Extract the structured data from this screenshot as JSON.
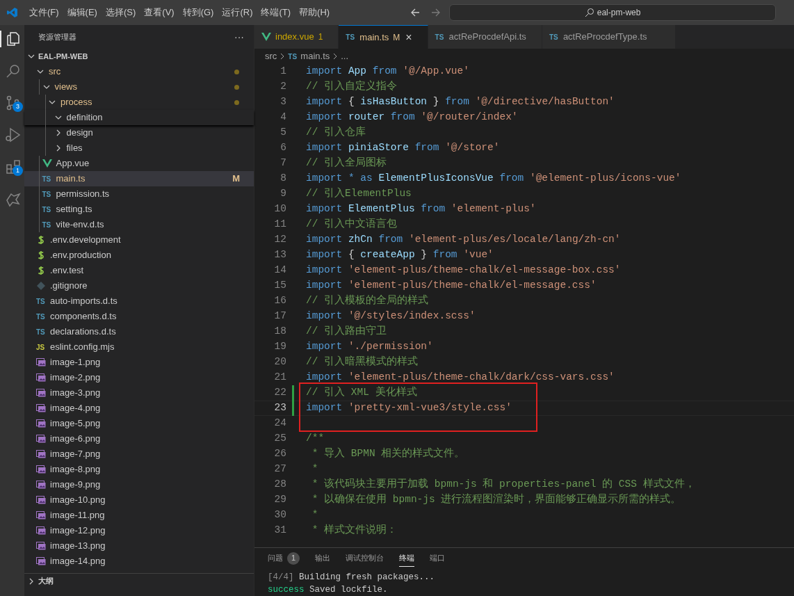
{
  "menu": [
    "文件(F)",
    "编辑(E)",
    "选择(S)",
    "查看(V)",
    "转到(G)",
    "运行(R)",
    "终端(T)",
    "帮助(H)"
  ],
  "search": {
    "value": "eal-pm-web"
  },
  "activity_bar": [
    {
      "kind": "files",
      "selected": true
    },
    {
      "kind": "search",
      "selected": false
    },
    {
      "kind": "source-control",
      "selected": false,
      "badge": "3"
    },
    {
      "kind": "run",
      "selected": false
    },
    {
      "kind": "extensions",
      "selected": false,
      "badge": "1"
    },
    {
      "kind": "remote",
      "selected": false
    }
  ],
  "sidebar": {
    "title": "资源管理器",
    "more": "···",
    "root": {
      "label": "EAL-PM-WEB",
      "expanded": true
    },
    "tree": [
      {
        "label": "src",
        "kind": "folder",
        "expanded": true,
        "modified": true,
        "children": [
          {
            "label": "views",
            "kind": "folder",
            "expanded": true,
            "modified": true,
            "children": [
              {
                "label": "process",
                "kind": "folder",
                "expanded": true,
                "modified": true,
                "children": [
                  {
                    "label": "definition",
                    "kind": "folder",
                    "expanded": true,
                    "sticky": true
                  },
                  {
                    "label": "design",
                    "kind": "folder",
                    "expanded": false
                  },
                  {
                    "label": "files",
                    "kind": "folder",
                    "expanded": false
                  }
                ]
              }
            ]
          },
          {
            "label": "App.vue",
            "kind": "vue"
          },
          {
            "label": "main.ts",
            "kind": "ts",
            "icon_text": "TS",
            "selected": true,
            "modified": true,
            "badge": "M"
          },
          {
            "label": "permission.ts",
            "kind": "ts",
            "icon_text": "TS"
          },
          {
            "label": "setting.ts",
            "kind": "ts",
            "icon_text": "TS"
          },
          {
            "label": "vite-env.d.ts",
            "kind": "ts",
            "icon_text": "TS"
          }
        ]
      },
      {
        "label": ".env.development",
        "kind": "env"
      },
      {
        "label": ".env.production",
        "kind": "env"
      },
      {
        "label": ".env.test",
        "kind": "env"
      },
      {
        "label": ".gitignore",
        "kind": "git"
      },
      {
        "label": "auto-imports.d.ts",
        "kind": "ts",
        "icon_text": "TS"
      },
      {
        "label": "components.d.ts",
        "kind": "ts",
        "icon_text": "TS"
      },
      {
        "label": "declarations.d.ts",
        "kind": "ts",
        "icon_text": "TS"
      },
      {
        "label": "eslint.config.mjs",
        "kind": "js",
        "icon_text": "JS"
      },
      {
        "label": "image-1.png",
        "kind": "image"
      },
      {
        "label": "image-2.png",
        "kind": "image"
      },
      {
        "label": "image-3.png",
        "kind": "image"
      },
      {
        "label": "image-4.png",
        "kind": "image"
      },
      {
        "label": "image-5.png",
        "kind": "image"
      },
      {
        "label": "image-6.png",
        "kind": "image"
      },
      {
        "label": "image-7.png",
        "kind": "image"
      },
      {
        "label": "image-8.png",
        "kind": "image"
      },
      {
        "label": "image-9.png",
        "kind": "image"
      },
      {
        "label": "image-10.png",
        "kind": "image"
      },
      {
        "label": "image-11.png",
        "kind": "image"
      },
      {
        "label": "image-12.png",
        "kind": "image"
      },
      {
        "label": "image-13.png",
        "kind": "image"
      },
      {
        "label": "image-14.png",
        "kind": "image"
      }
    ],
    "sections": [
      {
        "label": "大纲",
        "expanded": false
      }
    ]
  },
  "tabs": [
    {
      "label": "index.vue",
      "kind": "vue",
      "selected": false,
      "problems": true,
      "badge": "1"
    },
    {
      "label": "main.ts",
      "kind": "ts",
      "icon_text": "TS",
      "selected": true,
      "problems": false,
      "badge": "M",
      "close": "×"
    },
    {
      "label": "actReProcdefApi.ts",
      "kind": "ts",
      "icon_text": "TS",
      "selected": false,
      "problems": false
    },
    {
      "label": "actReProcdefType.ts",
      "kind": "ts",
      "icon_text": "TS",
      "selected": false,
      "problems": false
    }
  ],
  "breadcrumb": [
    {
      "label": "src"
    },
    {
      "label": "main.ts",
      "kind": "ts",
      "icon_text": "TS"
    },
    {
      "label": "..."
    }
  ],
  "code": [
    {
      "number": "1",
      "tokens": [
        {
          "kind": "keyword",
          "text": "import"
        },
        {
          "kind": "ident",
          "text": " App "
        },
        {
          "kind": "keyword",
          "text": "from"
        },
        {
          "kind": "string",
          "text": " '@/App.vue'"
        }
      ]
    },
    {
      "number": "2",
      "tokens": [
        {
          "kind": "comment",
          "text": "// 引入自定义指令"
        }
      ]
    },
    {
      "number": "3",
      "tokens": [
        {
          "kind": "keyword",
          "text": "import"
        },
        {
          "kind": "punct",
          "text": " { "
        },
        {
          "kind": "ident",
          "text": "isHasButton"
        },
        {
          "kind": "punct",
          "text": " } "
        },
        {
          "kind": "keyword",
          "text": "from"
        },
        {
          "kind": "string",
          "text": " '@/directive/hasButton'"
        }
      ]
    },
    {
      "number": "4",
      "tokens": [
        {
          "kind": "keyword",
          "text": "import"
        },
        {
          "kind": "ident",
          "text": " router "
        },
        {
          "kind": "keyword",
          "text": "from"
        },
        {
          "kind": "string",
          "text": " '@/router/index'"
        }
      ]
    },
    {
      "number": "5",
      "tokens": [
        {
          "kind": "comment",
          "text": "// 引入仓库"
        }
      ]
    },
    {
      "number": "6",
      "tokens": [
        {
          "kind": "keyword",
          "text": "import"
        },
        {
          "kind": "ident",
          "text": " piniaStore "
        },
        {
          "kind": "keyword",
          "text": "from"
        },
        {
          "kind": "string",
          "text": " '@/store'"
        }
      ]
    },
    {
      "number": "7",
      "tokens": [
        {
          "kind": "comment",
          "text": "// 引入全局图标"
        }
      ]
    },
    {
      "number": "8",
      "tokens": [
        {
          "kind": "keyword",
          "text": "import * as"
        },
        {
          "kind": "ident",
          "text": " ElementPlusIconsVue "
        },
        {
          "kind": "keyword",
          "text": "from"
        },
        {
          "kind": "string",
          "text": " '@element-plus/icons-vue'"
        }
      ]
    },
    {
      "number": "9",
      "tokens": [
        {
          "kind": "comment",
          "text": "// 引入ElementPlus"
        }
      ]
    },
    {
      "number": "10",
      "tokens": [
        {
          "kind": "keyword",
          "text": "import"
        },
        {
          "kind": "ident",
          "text": " ElementPlus "
        },
        {
          "kind": "keyword",
          "text": "from"
        },
        {
          "kind": "string",
          "text": " 'element-plus'"
        }
      ]
    },
    {
      "number": "11",
      "tokens": [
        {
          "kind": "comment",
          "text": "// 引入中文语言包"
        }
      ]
    },
    {
      "number": "12",
      "tokens": [
        {
          "kind": "keyword",
          "text": "import"
        },
        {
          "kind": "ident",
          "text": " zhCn "
        },
        {
          "kind": "keyword",
          "text": "from"
        },
        {
          "kind": "string",
          "text": " 'element-plus/es/locale/lang/zh-cn'"
        }
      ]
    },
    {
      "number": "13",
      "tokens": [
        {
          "kind": "keyword",
          "text": "import"
        },
        {
          "kind": "punct",
          "text": " { "
        },
        {
          "kind": "ident",
          "text": "createApp"
        },
        {
          "kind": "punct",
          "text": " } "
        },
        {
          "kind": "keyword",
          "text": "from"
        },
        {
          "kind": "string",
          "text": " 'vue'"
        }
      ]
    },
    {
      "number": "14",
      "tokens": [
        {
          "kind": "keyword",
          "text": "import"
        },
        {
          "kind": "string",
          "text": " 'element-plus/theme-chalk/el-message-box.css'"
        }
      ]
    },
    {
      "number": "15",
      "tokens": [
        {
          "kind": "keyword",
          "text": "import"
        },
        {
          "kind": "string",
          "text": " 'element-plus/theme-chalk/el-message.css'"
        }
      ]
    },
    {
      "number": "16",
      "tokens": [
        {
          "kind": "comment",
          "text": "// 引入模板的全局的样式"
        }
      ]
    },
    {
      "number": "17",
      "tokens": [
        {
          "kind": "keyword",
          "text": "import"
        },
        {
          "kind": "string",
          "text": " '@/styles/index.scss'"
        }
      ]
    },
    {
      "number": "18",
      "tokens": [
        {
          "kind": "comment",
          "text": "// 引入路由守卫"
        }
      ]
    },
    {
      "number": "19",
      "tokens": [
        {
          "kind": "keyword",
          "text": "import"
        },
        {
          "kind": "string",
          "text": " './permission'"
        }
      ]
    },
    {
      "number": "20",
      "tokens": [
        {
          "kind": "comment",
          "text": "// 引入暗黑模式的样式"
        }
      ]
    },
    {
      "number": "21",
      "tokens": [
        {
          "kind": "keyword",
          "text": "import"
        },
        {
          "kind": "string",
          "text": " 'element-plus/theme-chalk/dark/css-vars.css'"
        }
      ]
    },
    {
      "number": "22",
      "modified": true,
      "boxed": true,
      "tokens": [
        {
          "kind": "comment",
          "text": "// 引入 XML 美化样式"
        }
      ]
    },
    {
      "number": "23",
      "modified": true,
      "boxed": true,
      "current": true,
      "tokens": [
        {
          "kind": "keyword",
          "text": "import"
        },
        {
          "kind": "string",
          "text": " 'pretty-xml-vue3/style.css'"
        }
      ]
    },
    {
      "number": "24",
      "boxed": true
    },
    {
      "number": "25",
      "tokens": [
        {
          "kind": "comment",
          "text": "/**"
        }
      ]
    },
    {
      "number": "26",
      "tokens": [
        {
          "kind": "comment",
          "text": " * 导入 BPMN 相关的样式文件。"
        }
      ]
    },
    {
      "number": "27",
      "tokens": [
        {
          "kind": "comment",
          "text": " *"
        }
      ]
    },
    {
      "number": "28",
      "tokens": [
        {
          "kind": "comment",
          "text": " * 该代码块主要用于加载 bpmn-js 和 properties-panel 的 CSS 样式文件，"
        }
      ]
    },
    {
      "number": "29",
      "tokens": [
        {
          "kind": "comment",
          "text": " * 以确保在使用 bpmn-js 进行流程图渲染时，界面能够正确显示所需的样式。"
        }
      ]
    },
    {
      "number": "30",
      "tokens": [
        {
          "kind": "comment",
          "text": " *"
        }
      ]
    },
    {
      "number": "31",
      "tokens": [
        {
          "kind": "comment",
          "text": " * 样式文件说明："
        }
      ]
    }
  ],
  "panel": {
    "tabs": [
      {
        "label": "问题",
        "selected": false,
        "badge": "1"
      },
      {
        "label": "输出",
        "selected": false
      },
      {
        "label": "调试控制台",
        "selected": false
      },
      {
        "label": "终端",
        "selected": true
      },
      {
        "label": "端口",
        "selected": false
      }
    ],
    "terminal": [
      [
        {
          "kind": "dim",
          "text": "[4/4]"
        },
        {
          "kind": "plain",
          "text": " Building fresh packages..."
        }
      ],
      [
        {
          "kind": "success",
          "text": "success"
        },
        {
          "kind": "plain",
          "text": " Saved lockfile."
        }
      ]
    ]
  }
}
